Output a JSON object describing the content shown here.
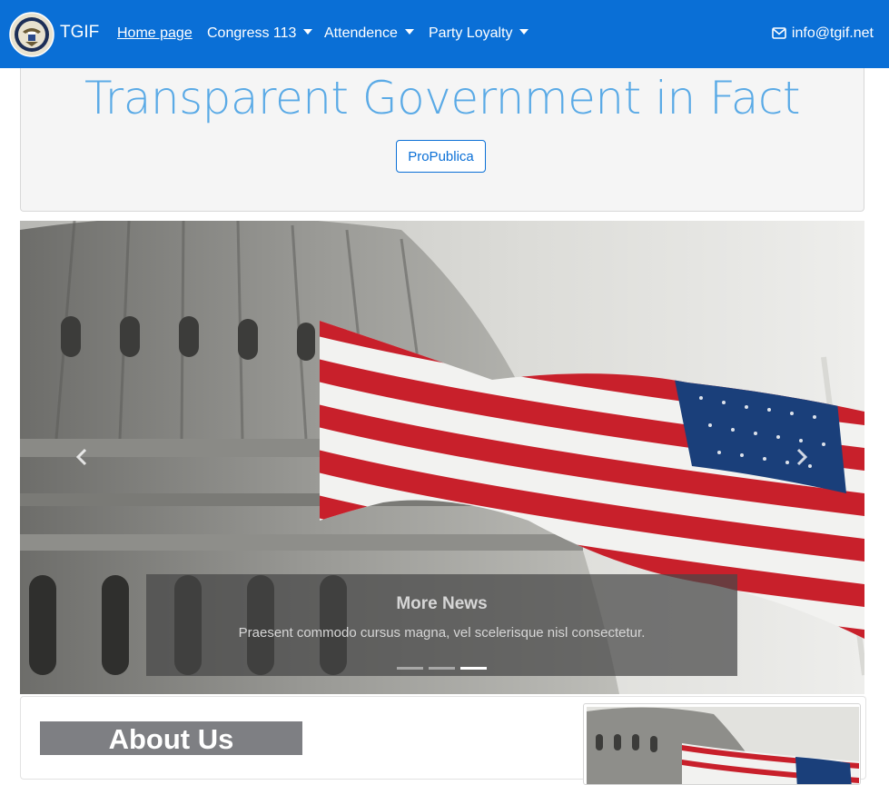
{
  "navbar": {
    "brand": "TGIF",
    "logo_icon": "house-of-representatives-seal-icon",
    "links": [
      {
        "label": "Home page",
        "active": true
      },
      {
        "label": "Congress 113",
        "dropdown": true
      },
      {
        "label": "Attendence",
        "dropdown": true
      },
      {
        "label": "Party Loyalty",
        "dropdown": true
      }
    ],
    "email": "info@tgif.net",
    "email_icon": "envelope-icon",
    "background": "#0a6fd6"
  },
  "jumbotron": {
    "title": "Transparent Government in Fact",
    "button_label": "ProPublica",
    "title_color": "#5aaae6"
  },
  "carousel": {
    "image": "capitol-dome-with-us-flag",
    "prev_icon": "chevron-left-icon",
    "next_icon": "chevron-right-icon",
    "caption_title": "More News",
    "caption_text": "Praesent commodo cursus magna, vel scelerisque nisl consectetur.",
    "slide_count": 3,
    "active_slide": 3
  },
  "about": {
    "heading": "About Us",
    "image": "capitol-dome-with-us-flag"
  }
}
